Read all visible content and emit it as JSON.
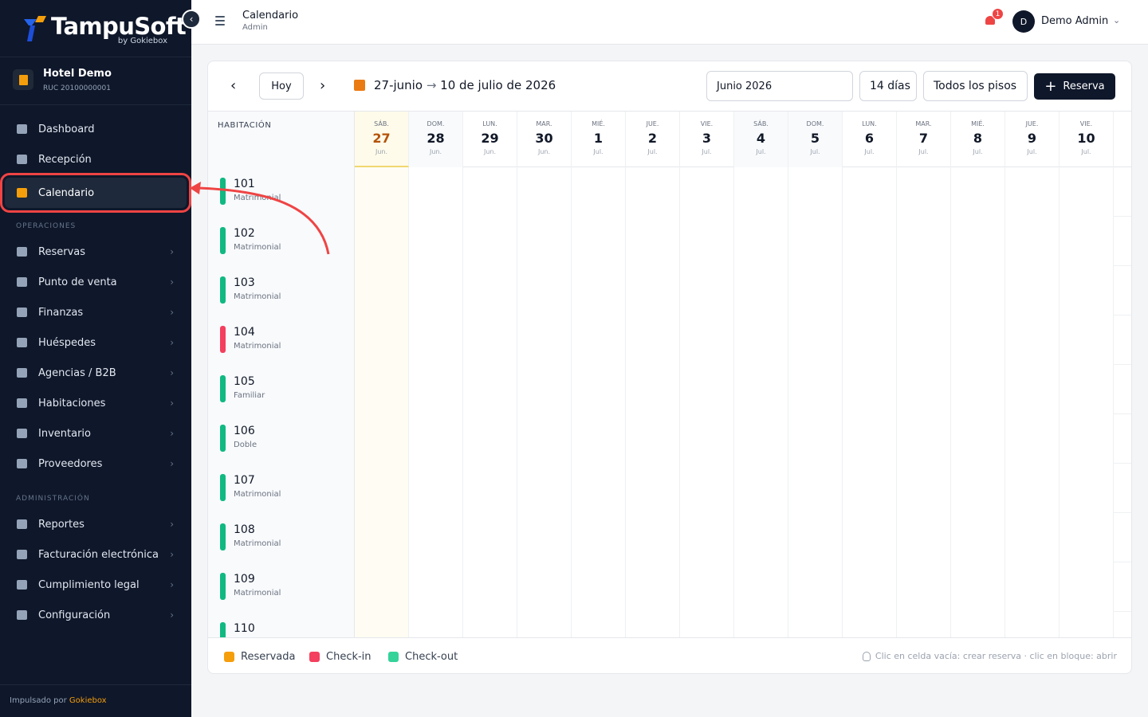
{
  "brand": {
    "name": "TampuSoft",
    "sub": "by Gokiebox"
  },
  "hotel": {
    "name": "Hotel Demo",
    "ruc": "RUC 20100000001"
  },
  "nav": {
    "top": [
      {
        "label": "Dashboard",
        "icon": "dashboard-icon"
      },
      {
        "label": "Recepción",
        "icon": "reception-icon"
      },
      {
        "label": "Calendario",
        "icon": "calendar-icon",
        "active": true
      }
    ],
    "operations_label": "OPERACIONES",
    "operations": [
      {
        "label": "Reservas",
        "icon": "reservations-icon"
      },
      {
        "label": "Punto de venta",
        "icon": "pos-icon"
      },
      {
        "label": "Finanzas",
        "icon": "finance-icon"
      },
      {
        "label": "Huéspedes",
        "icon": "guests-icon"
      },
      {
        "label": "Agencias / B2B",
        "icon": "agencies-icon"
      },
      {
        "label": "Habitaciones",
        "icon": "rooms-icon"
      },
      {
        "label": "Inventario",
        "icon": "inventory-icon"
      },
      {
        "label": "Proveedores",
        "icon": "suppliers-icon"
      }
    ],
    "admin_label": "ADMINISTRACIÓN",
    "admin": [
      {
        "label": "Reportes",
        "icon": "reports-icon"
      },
      {
        "label": "Facturación electrónica",
        "icon": "invoice-icon"
      },
      {
        "label": "Cumplimiento legal",
        "icon": "legal-icon"
      },
      {
        "label": "Configuración",
        "icon": "settings-icon"
      }
    ]
  },
  "footer": {
    "prefix": "Impulsado por ",
    "brand": "Gokiebox"
  },
  "topbar": {
    "title": "Calendario",
    "subtitle": "Admin",
    "notifications": "1",
    "avatar_initial": "D",
    "user": "Demo Admin"
  },
  "toolbar": {
    "today": "Hoy",
    "range_start": "27-junio",
    "range_arrow": "→",
    "range_end": "10 de julio de 2026",
    "month": "Junio 2026",
    "days": "14 días",
    "floors": "Todos los pisos",
    "reserve": "Reserva"
  },
  "grid": {
    "room_header": "HABITACIÓN",
    "days": [
      {
        "dow": "SÁB.",
        "num": "27",
        "mon": "Jun.",
        "today": true
      },
      {
        "dow": "DOM.",
        "num": "28",
        "mon": "Jun.",
        "weekend": true
      },
      {
        "dow": "LUN.",
        "num": "29",
        "mon": "Jun."
      },
      {
        "dow": "MAR.",
        "num": "30",
        "mon": "Jun."
      },
      {
        "dow": "MIÉ.",
        "num": "1",
        "mon": "Jul."
      },
      {
        "dow": "JUE.",
        "num": "2",
        "mon": "Jul."
      },
      {
        "dow": "VIE.",
        "num": "3",
        "mon": "Jul."
      },
      {
        "dow": "SÁB.",
        "num": "4",
        "mon": "Jul.",
        "weekend": true
      },
      {
        "dow": "DOM.",
        "num": "5",
        "mon": "Jul.",
        "weekend": true
      },
      {
        "dow": "LUN.",
        "num": "6",
        "mon": "Jul."
      },
      {
        "dow": "MAR.",
        "num": "7",
        "mon": "Jul."
      },
      {
        "dow": "MIÉ.",
        "num": "8",
        "mon": "Jul."
      },
      {
        "dow": "JUE.",
        "num": "9",
        "mon": "Jul."
      },
      {
        "dow": "VIE.",
        "num": "10",
        "mon": "Jul."
      }
    ],
    "rooms": [
      {
        "num": "101",
        "type": "Matrimonial",
        "status_color": "#10b981"
      },
      {
        "num": "102",
        "type": "Matrimonial",
        "status_color": "#10b981"
      },
      {
        "num": "103",
        "type": "Matrimonial",
        "status_color": "#10b981"
      },
      {
        "num": "104",
        "type": "Matrimonial",
        "status_color": "#f43f5e"
      },
      {
        "num": "105",
        "type": "Familiar",
        "status_color": "#10b981"
      },
      {
        "num": "106",
        "type": "Doble",
        "status_color": "#10b981"
      },
      {
        "num": "107",
        "type": "Matrimonial",
        "status_color": "#10b981"
      },
      {
        "num": "108",
        "type": "Matrimonial",
        "status_color": "#10b981"
      },
      {
        "num": "109",
        "type": "Matrimonial",
        "status_color": "#10b981"
      },
      {
        "num": "110",
        "type": "",
        "status_color": "#10b981"
      }
    ]
  },
  "legend": {
    "items": [
      {
        "label": "Reservada",
        "color": "#f59e0b"
      },
      {
        "label": "Check-in",
        "color": "#f43f5e"
      },
      {
        "label": "Check-out",
        "color": "#34d399"
      }
    ],
    "hint": "Clic en celda vacía: crear reserva · clic en bloque: abrir"
  }
}
